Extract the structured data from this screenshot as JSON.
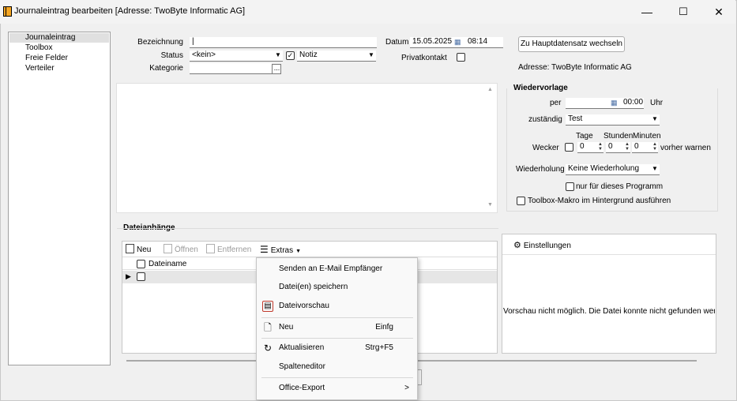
{
  "window": {
    "title": "Journaleintrag bearbeiten [Adresse: TwoByte Informatic AG]",
    "minimize": "—",
    "maximize": "☐",
    "close": "✕"
  },
  "sidebar": {
    "items": [
      {
        "label": "Journaleintrag",
        "selected": true
      },
      {
        "label": "Toolbox"
      },
      {
        "label": "Freie Felder"
      },
      {
        "label": "Verteiler"
      }
    ]
  },
  "form": {
    "bezeichnung_label": "Bezeichnung",
    "bezeichnung_value": "|",
    "status_label": "Status",
    "status_value": "<kein>",
    "notiz_value": "Notiz",
    "kategorie_label": "Kategorie",
    "kategorie_value": "",
    "kategorie_button": "...",
    "datum_label": "Datum",
    "datum_value": "15.05.2025",
    "time_value": "08:14",
    "privatkontakt_label": "Privatkontakt",
    "hauptdatensatz_button": "Zu Hauptdatensatz wechseln",
    "adresse_text": "Adresse: TwoByte Informatic AG"
  },
  "wiedervorlage": {
    "title": "Wiedervorlage",
    "per_label": "per",
    "per_date": "",
    "per_time": "00:00",
    "uhr_label": "Uhr",
    "zustaendig_label": "zuständig",
    "zustaendig_value": "Test",
    "tage_label": "Tage",
    "stunden_label": "Stunden",
    "minuten_label": "Minuten",
    "wecker_label": "Wecker",
    "tage_value": "0",
    "stunden_value": "0",
    "minuten_value": "0",
    "vorher_label": "vorher warnen",
    "wiederholung_label": "Wiederholung",
    "wiederholung_value": "Keine Wiederholung",
    "nur_programm_label": "nur für dieses Programm",
    "toolbox_makro_label": "Toolbox-Makro im Hintergrund ausführen"
  },
  "dateianhaenge": {
    "title": "Dateianhänge",
    "toolbar": {
      "neu": "Neu",
      "oeffnen": "Öffnen",
      "entfernen": "Entfernen",
      "extras": "Extras"
    },
    "column_header": "Dateiname"
  },
  "preview": {
    "settings_label": "Einstellungen",
    "message": "Vorschau nicht möglich. Die Datei konnte nicht gefunden werder"
  },
  "context_menu": {
    "items": [
      {
        "label": "Senden an E-Mail Empfänger",
        "shortcut": ""
      },
      {
        "label": "Datei(en) speichern",
        "shortcut": ""
      },
      {
        "label": "Dateivorschau",
        "shortcut": ""
      },
      {
        "label": "Neu",
        "shortcut": "Einfg"
      },
      {
        "label": "Aktualisieren",
        "shortcut": "Strg+F5"
      },
      {
        "label": "Spalteneditor",
        "shortcut": ""
      },
      {
        "label": "Office-Export",
        "shortcut": ">"
      }
    ]
  },
  "colors": {
    "window_bg": "#f0f0f0",
    "menu_bg": "#f9f9f9",
    "accent_highlight": "#c0392b"
  }
}
